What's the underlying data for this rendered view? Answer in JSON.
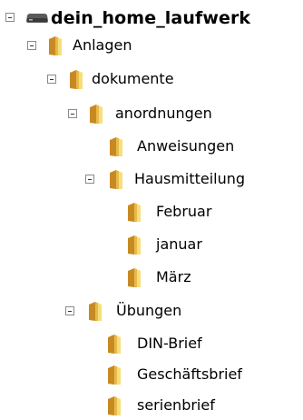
{
  "tree": {
    "root": {
      "label": "dein_home_laufwerk",
      "icon": "drive-icon",
      "state": "expanded"
    },
    "nodes": [
      {
        "label": "Anlagen",
        "icon": "folder-icon",
        "state": "expanded"
      },
      {
        "label": "dokumente",
        "icon": "folder-icon",
        "state": "expanded"
      },
      {
        "label": "anordnungen",
        "icon": "folder-icon",
        "state": "expanded"
      },
      {
        "label": "Anweisungen",
        "icon": "folder-icon",
        "state": "leaf"
      },
      {
        "label": "Hausmitteilung",
        "icon": "folder-icon",
        "state": "expanded"
      },
      {
        "label": "Februar",
        "icon": "folder-icon",
        "state": "leaf"
      },
      {
        "label": "januar",
        "icon": "folder-icon",
        "state": "leaf"
      },
      {
        "label": "März",
        "icon": "folder-icon",
        "state": "leaf"
      },
      {
        "label": "Übungen",
        "icon": "folder-icon",
        "state": "expanded"
      },
      {
        "label": "DIN-Brief",
        "icon": "folder-icon",
        "state": "leaf"
      },
      {
        "label": "Geschäftsbrief",
        "icon": "folder-icon",
        "state": "leaf"
      },
      {
        "label": "serienbrief",
        "icon": "folder-icon",
        "state": "leaf"
      }
    ]
  },
  "colors": {
    "folder_light": "#f6df7a",
    "folder_mid": "#e8b84a",
    "folder_dark": "#c78a22",
    "drive_body": "#4a4a4a",
    "expander_border": "#8a8a8a"
  }
}
